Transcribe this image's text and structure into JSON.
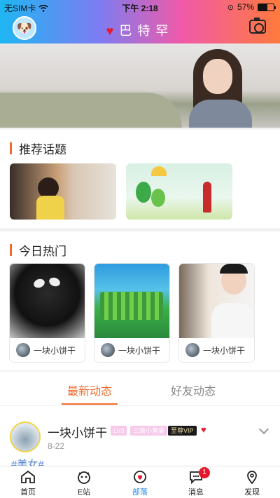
{
  "status": {
    "carrier": "无SIM卡",
    "time": "下午 2:18",
    "battery": "57%",
    "battery_level": 0.57
  },
  "nav": {
    "title": "巴特罕"
  },
  "sections": {
    "topics": {
      "title": "推荐话题"
    },
    "hot": {
      "title": "今日热门",
      "cards": [
        {
          "user": "一块小饼干"
        },
        {
          "user": "一块小饼干"
        },
        {
          "user": "一块小饼干"
        }
      ]
    }
  },
  "tabs": {
    "latest": "最新动态",
    "friends": "好友动态"
  },
  "post": {
    "name": "一块小饼干",
    "level": "LV3",
    "rank": "三级小富豪",
    "vip": "至尊VIP",
    "date": "8-22",
    "tag": "#美女#"
  },
  "tabbar": {
    "items": [
      {
        "label": "首页",
        "icon": "home-icon"
      },
      {
        "label": "E站",
        "icon": "e-station-icon"
      },
      {
        "label": "部落",
        "icon": "tribe-icon"
      },
      {
        "label": "消息",
        "icon": "message-icon",
        "badge": "1"
      },
      {
        "label": "发现",
        "icon": "location-pin-icon"
      }
    ]
  },
  "colors": {
    "accent": "#f26b2a",
    "active_tab": "#2b8de0",
    "badge_red": "#e8182c"
  }
}
